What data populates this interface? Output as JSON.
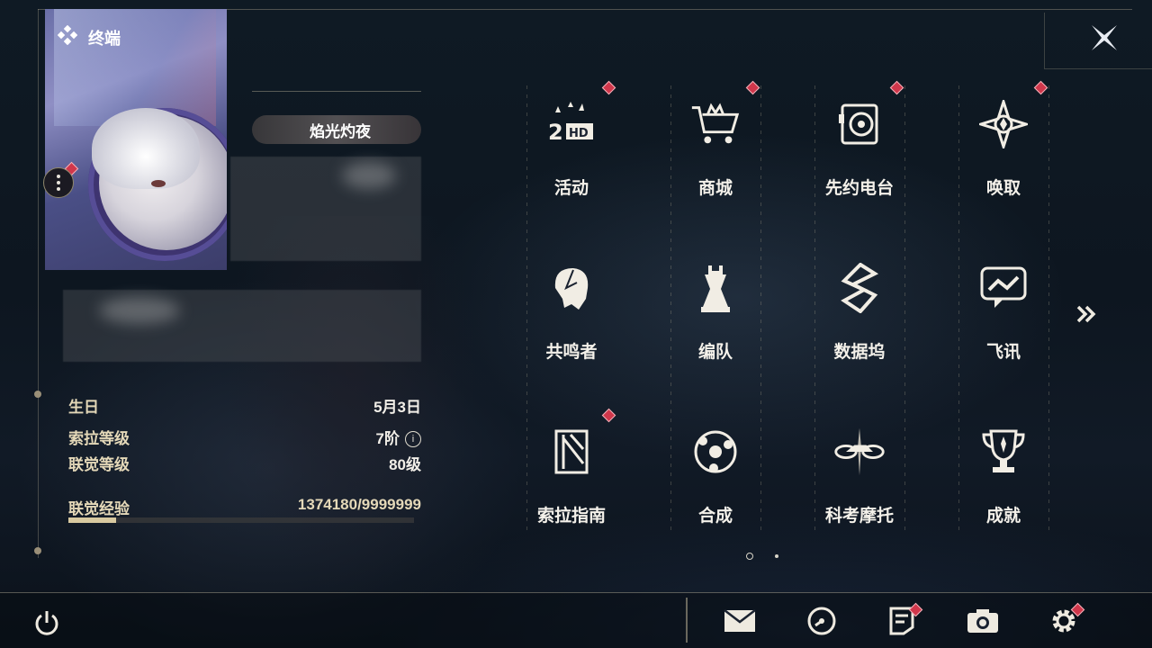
{
  "header": {
    "title": "终端"
  },
  "profile": {
    "title_badge": "焰光灼夜",
    "info": [
      {
        "label": "生日",
        "value": "5月3日"
      },
      {
        "label": "索拉等级",
        "value": "7阶"
      },
      {
        "label": "联觉等级",
        "value": "80级"
      }
    ],
    "exp": {
      "label": "联觉经验",
      "value": "1374180/9999999",
      "progress": 0.137
    }
  },
  "menu": [
    {
      "label": "活动",
      "icon": "event-icon",
      "badge": true
    },
    {
      "label": "商城",
      "icon": "shop-crown-cart-icon",
      "badge": true
    },
    {
      "label": "先约电台",
      "icon": "radio-icon",
      "badge": true
    },
    {
      "label": "唤取",
      "icon": "convene-compass-icon",
      "badge": true
    },
    {
      "label": "共鸣者",
      "icon": "resonator-head-icon",
      "badge": false
    },
    {
      "label": "编队",
      "icon": "team-chess-icon",
      "badge": false
    },
    {
      "label": "数据坞",
      "icon": "data-bank-icon",
      "badge": false
    },
    {
      "label": "飞讯",
      "icon": "chat-message-icon",
      "badge": false
    },
    {
      "label": "索拉指南",
      "icon": "guidebook-icon",
      "badge": true
    },
    {
      "label": "合成",
      "icon": "synthesis-icon",
      "badge": false
    },
    {
      "label": "科考摩托",
      "icon": "motorcycle-icon",
      "badge": false
    },
    {
      "label": "成就",
      "icon": "trophy-icon",
      "badge": false
    }
  ],
  "pagination": {
    "current": 1,
    "total": 2
  },
  "bottom_bar": [
    {
      "name": "mail",
      "icon": "mail-icon",
      "badge": false
    },
    {
      "name": "clock",
      "icon": "clock-icon",
      "badge": false
    },
    {
      "name": "notice",
      "icon": "notice-icon",
      "badge": true
    },
    {
      "name": "camera",
      "icon": "camera-icon",
      "badge": false
    },
    {
      "name": "settings",
      "icon": "gear-icon",
      "badge": true
    }
  ],
  "colors": {
    "accent": "#d8c9a0",
    "badge_red": "#d0374b",
    "text_gold": "#e4d8b8"
  }
}
